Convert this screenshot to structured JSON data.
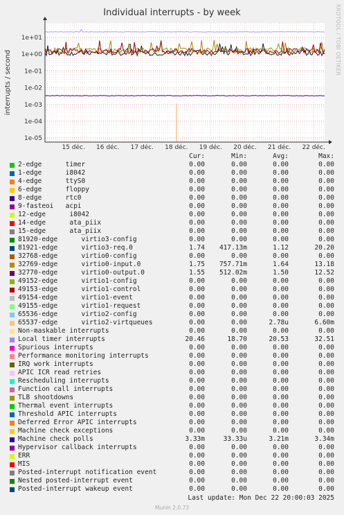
{
  "title": "Individual interrupts - by week",
  "side_label": "RRDTOOL / TOBI OETIKER",
  "footer": {
    "last_update": "Last update: Mon Dec 22 20:00:03 2025",
    "munin": "Munin 2.0.73"
  },
  "chart_data": {
    "type": "line",
    "title": "Individual interrupts - by week",
    "ylabel": "interrupts / second",
    "yscale": "log",
    "ylim": [
      5.5e-06,
      70
    ],
    "ytick_labels": [
      "1e+01",
      "1e+00",
      "1e-01",
      "1e-02",
      "1e-03",
      "1e-04",
      "1e-05"
    ],
    "ytick_values": [
      10,
      1,
      0.1,
      0.01,
      0.001,
      0.0001,
      1e-05
    ],
    "xtick_labels": [
      "15 déc.",
      "16 déc.",
      "17 déc.",
      "18 déc.",
      "19 déc.",
      "20 déc.",
      "21 déc.",
      "22 déc."
    ],
    "grid": true,
    "series_plotted": [
      {
        "name": "Local timer interrupts",
        "color": "#aa99ff",
        "level": 20.5
      },
      {
        "name": "virtio3-req.0",
        "color": "#112233",
        "level": 1.12
      },
      {
        "name": "virtio0-input.0",
        "color": "#aa8800",
        "level": 1.64
      },
      {
        "name": "virtio0-output.0",
        "color": "#990000",
        "level": 1.5
      },
      {
        "name": "Machine check polls",
        "color": "#440099",
        "level": 0.00321
      },
      {
        "name": "virtio2-virtqueues",
        "color": "#ffbb77",
        "spike": 0.00108,
        "spike_day": "18 déc."
      }
    ]
  },
  "legend": {
    "headers": {
      "cur": "Cur:",
      "min": "Min:",
      "avg": "Avg:",
      "max": "Max:"
    },
    "rows": [
      {
        "name": "2-edge      timer",
        "color": "#00cc00",
        "cur": "0.00",
        "min": "0.00",
        "avg": "0.00",
        "max": "0.00"
      },
      {
        "name": "1-edge      i8042",
        "color": "#0066b3",
        "cur": "0.00",
        "min": "0.00",
        "avg": "0.00",
        "max": "0.00"
      },
      {
        "name": "4-edge      ttyS0",
        "color": "#ff8000",
        "cur": "0.00",
        "min": "0.00",
        "avg": "0.00",
        "max": "0.00"
      },
      {
        "name": "6-edge      floppy",
        "color": "#ffcc00",
        "cur": "0.00",
        "min": "0.00",
        "avg": "0.00",
        "max": "0.00"
      },
      {
        "name": "8-edge      rtc0",
        "color": "#330099",
        "cur": "0.00",
        "min": "0.00",
        "avg": "0.00",
        "max": "0.00"
      },
      {
        "name": "9-fasteoi   acpi",
        "color": "#990099",
        "cur": "0.00",
        "min": "0.00",
        "avg": "0.00",
        "max": "0.00"
      },
      {
        "name": "12-edge      i8042",
        "color": "#ccff00",
        "cur": "0.00",
        "min": "0.00",
        "avg": "0.00",
        "max": "0.00"
      },
      {
        "name": "14-edge      ata_piix",
        "color": "#ff0000",
        "cur": "0.00",
        "min": "0.00",
        "avg": "0.00",
        "max": "0.00"
      },
      {
        "name": "15-edge      ata_piix",
        "color": "#808080",
        "cur": "0.00",
        "min": "0.00",
        "avg": "0.00",
        "max": "0.00"
      },
      {
        "name": "81920-edge      virtio3-config",
        "color": "#008f00",
        "cur": "0.00",
        "min": "0.00",
        "avg": "0.00",
        "max": "0.00"
      },
      {
        "name": "81921-edge      virtio3-req.0",
        "color": "#00487d",
        "cur": "1.74",
        "min": "417.13m",
        "avg": "1.12",
        "max": "20.20"
      },
      {
        "name": "32768-edge      virtio0-config",
        "color": "#b35a00",
        "cur": "0.00",
        "min": "0.00",
        "avg": "0.00",
        "max": "0.00"
      },
      {
        "name": "32769-edge      virtio0-input.0",
        "color": "#b38f00",
        "cur": "1.75",
        "min": "757.71m",
        "avg": "1.64",
        "max": "13.18"
      },
      {
        "name": "32770-edge      virtio0-output.0",
        "color": "#6b006b",
        "cur": "1.55",
        "min": "512.02m",
        "avg": "1.50",
        "max": "12.52"
      },
      {
        "name": "49152-edge      virtio1-config",
        "color": "#8fb300",
        "cur": "0.00",
        "min": "0.00",
        "avg": "0.00",
        "max": "0.00"
      },
      {
        "name": "49153-edge      virtio1-control",
        "color": "#b30000",
        "cur": "0.00",
        "min": "0.00",
        "avg": "0.00",
        "max": "0.00"
      },
      {
        "name": "49154-edge      virtio1-event",
        "color": "#bebebe",
        "cur": "0.00",
        "min": "0.00",
        "avg": "0.00",
        "max": "0.00"
      },
      {
        "name": "49155-edge      virtio1-request",
        "color": "#80ff80",
        "cur": "0.00",
        "min": "0.00",
        "avg": "0.00",
        "max": "0.00"
      },
      {
        "name": "65536-edge      virtio2-config",
        "color": "#80c9ff",
        "cur": "0.00",
        "min": "0.00",
        "avg": "0.00",
        "max": "0.00"
      },
      {
        "name": "65537-edge      virtio2-virtqueues",
        "color": "#ffc080",
        "cur": "0.00",
        "min": "0.00",
        "avg": "2.78u",
        "max": "6.60m"
      },
      {
        "name": "Non-maskable interrupts",
        "color": "#ffe680",
        "cur": "0.00",
        "min": "0.00",
        "avg": "0.00",
        "max": "0.00"
      },
      {
        "name": "Local timer interrupts",
        "color": "#aa80ff",
        "cur": "20.46",
        "min": "18.70",
        "avg": "20.53",
        "max": "32.51"
      },
      {
        "name": "Spurious interrupts",
        "color": "#ee00cc",
        "cur": "0.00",
        "min": "0.00",
        "avg": "0.00",
        "max": "0.00"
      },
      {
        "name": "Performance monitoring interrupts",
        "color": "#ff8080",
        "cur": "0.00",
        "min": "0.00",
        "avg": "0.00",
        "max": "0.00"
      },
      {
        "name": "IRQ work interrupts",
        "color": "#666600",
        "cur": "0.00",
        "min": "0.00",
        "avg": "0.00",
        "max": "0.00"
      },
      {
        "name": "APIC ICR read retries",
        "color": "#ffbfff",
        "cur": "0.00",
        "min": "0.00",
        "avg": "0.00",
        "max": "0.00"
      },
      {
        "name": "Rescheduling interrupts",
        "color": "#00ffcc",
        "cur": "0.00",
        "min": "0.00",
        "avg": "0.00",
        "max": "0.00"
      },
      {
        "name": "Function call interrupts",
        "color": "#cc6699",
        "cur": "0.00",
        "min": "0.00",
        "avg": "0.00",
        "max": "0.00"
      },
      {
        "name": "TLB shootdowns",
        "color": "#999900",
        "cur": "0.00",
        "min": "0.00",
        "avg": "0.00",
        "max": "0.00"
      },
      {
        "name": "Thermal event interrupts",
        "color": "#00cc00",
        "cur": "0.00",
        "min": "0.00",
        "avg": "0.00",
        "max": "0.00"
      },
      {
        "name": "Threshold APIC interrupts",
        "color": "#0066b3",
        "cur": "0.00",
        "min": "0.00",
        "avg": "0.00",
        "max": "0.00"
      },
      {
        "name": "Deferred Error APIC interrupts",
        "color": "#ff8000",
        "cur": "0.00",
        "min": "0.00",
        "avg": "0.00",
        "max": "0.00"
      },
      {
        "name": "Machine check exceptions",
        "color": "#ffcc00",
        "cur": "0.00",
        "min": "0.00",
        "avg": "0.00",
        "max": "0.00"
      },
      {
        "name": "Machine check polls",
        "color": "#330099",
        "cur": "3.33m",
        "min": "33.33u",
        "avg": "3.21m",
        "max": "3.34m"
      },
      {
        "name": "Hypervisor callback interrupts",
        "color": "#990099",
        "cur": "0.00",
        "min": "0.00",
        "avg": "0.00",
        "max": "0.00"
      },
      {
        "name": "ERR",
        "color": "#ccff00",
        "cur": "0.00",
        "min": "0.00",
        "avg": "0.00",
        "max": "0.00"
      },
      {
        "name": "MIS",
        "color": "#ff0000",
        "cur": "0.00",
        "min": "0.00",
        "avg": "0.00",
        "max": "0.00"
      },
      {
        "name": "Posted-interrupt notification event",
        "color": "#808080",
        "cur": "0.00",
        "min": "0.00",
        "avg": "0.00",
        "max": "0.00"
      },
      {
        "name": "Nested posted-interrupt event",
        "color": "#008f00",
        "cur": "0.00",
        "min": "0.00",
        "avg": "0.00",
        "max": "0.00"
      },
      {
        "name": "Posted-interrupt wakeup event",
        "color": "#00487d",
        "cur": "0.00",
        "min": "0.00",
        "avg": "0.00",
        "max": "0.00"
      }
    ]
  }
}
